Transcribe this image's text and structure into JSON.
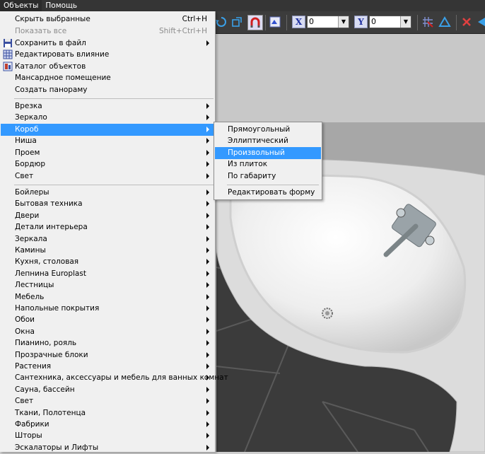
{
  "menubar": {
    "items": [
      {
        "label": "Объекты"
      },
      {
        "label": "Помощь"
      }
    ]
  },
  "toolbar": {
    "x_label": "X",
    "x_value": "0",
    "y_label": "Y",
    "y_value": "0"
  },
  "menu": {
    "group1": [
      {
        "label": "Скрыть выбранные",
        "shortcut": "Ctrl+H"
      },
      {
        "label": "Показать все",
        "shortcut": "Shift+Ctrl+H"
      },
      {
        "label": "Сохранить в файл"
      },
      {
        "label": "Редактировать влияние"
      },
      {
        "label": "Каталог объектов"
      },
      {
        "label": "Мансардное помещение"
      },
      {
        "label": "Создать панораму"
      }
    ],
    "group2": [
      {
        "label": "Врезка"
      },
      {
        "label": "Зеркало"
      },
      {
        "label": "Короб"
      },
      {
        "label": "Ниша"
      },
      {
        "label": "Проем"
      },
      {
        "label": "Бордюр"
      },
      {
        "label": "Свет"
      }
    ],
    "group3": [
      {
        "label": "Бойлеры"
      },
      {
        "label": "Бытовая техника"
      },
      {
        "label": "Двери"
      },
      {
        "label": "Детали интерьера"
      },
      {
        "label": "Зеркала"
      },
      {
        "label": "Камины"
      },
      {
        "label": "Кухня, столовая"
      },
      {
        "label": "Лепнина Europlast"
      },
      {
        "label": "Лестницы"
      },
      {
        "label": "Мебель"
      },
      {
        "label": "Напольные покрытия"
      },
      {
        "label": "Обои"
      },
      {
        "label": "Окна"
      },
      {
        "label": "Пианино, рояль"
      },
      {
        "label": "Прозрачные блоки"
      },
      {
        "label": "Растения"
      },
      {
        "label": "Сантехника, аксессуары и мебель для ванных комнат"
      },
      {
        "label": "Сауна, бассейн"
      },
      {
        "label": "Свет"
      },
      {
        "label": "Ткани, Полотенца"
      },
      {
        "label": "Фабрики"
      },
      {
        "label": "Шторы"
      },
      {
        "label": "Эскалаторы и Лифты"
      }
    ]
  },
  "submenu": {
    "items": [
      {
        "label": "Прямоугольный"
      },
      {
        "label": "Эллиптический"
      },
      {
        "label": "Произвольный"
      },
      {
        "label": "Из плиток"
      },
      {
        "label": "По габариту"
      }
    ],
    "edit_label": "Редактировать форму"
  },
  "colors": {
    "highlight": "#3399ff",
    "menu_bg": "#f0f0f0",
    "menubar_bg": "#353535",
    "toolbar_bg": "#3c3c3c"
  }
}
